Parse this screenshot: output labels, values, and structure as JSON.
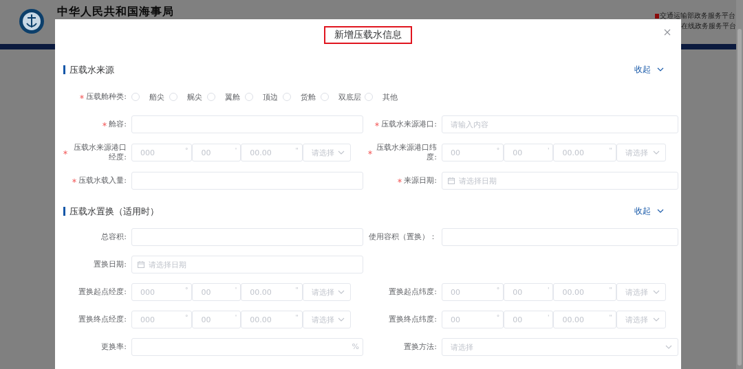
{
  "site": {
    "title": "中华人民共和国海事局",
    "platform_links": [
      "交通运输部政务服务平台",
      "在线政务服务平台"
    ]
  },
  "dialog": {
    "title": "新增压载水信息",
    "sections": [
      {
        "title": "压载水来源",
        "toggle": "收起",
        "rows": [
          [
            {
              "kind": "radio",
              "label": "压载舱种类:",
              "required": true,
              "options": [
                {
                  "label": "艏尖",
                  "selected": false
                },
                {
                  "label": "艉尖",
                  "selected": false
                },
                {
                  "label": "翼舱",
                  "selected": false
                },
                {
                  "label": "顶边",
                  "selected": false
                },
                {
                  "label": "货舱",
                  "selected": false
                },
                {
                  "label": "双底层",
                  "selected": false
                },
                {
                  "label": "其他",
                  "selected": false
                }
              ]
            }
          ],
          [
            {
              "kind": "text",
              "label": "舱容:",
              "required": true
            },
            {
              "kind": "text",
              "label": "压载水来源港口:",
              "required": true,
              "placeholder": "请输入内容"
            }
          ],
          [
            {
              "kind": "coord",
              "label": "压载水来源港口经度:",
              "required": true,
              "parts": [
                {
                  "placeholder": "000",
                  "unit": "°"
                },
                {
                  "placeholder": "00",
                  "unit": "'"
                },
                {
                  "placeholder": "00.00",
                  "unit": "\""
                }
              ],
              "select": "请选择"
            },
            {
              "kind": "coord",
              "label": "压载水来源港口纬度:",
              "required": true,
              "parts": [
                {
                  "placeholder": "00",
                  "unit": "°"
                },
                {
                  "placeholder": "00",
                  "unit": "'"
                },
                {
                  "placeholder": "00.00",
                  "unit": "\""
                }
              ],
              "select": "请选择"
            }
          ],
          [
            {
              "kind": "text",
              "label": "压载水载入量:",
              "required": true
            },
            {
              "kind": "date",
              "label": "来源日期:",
              "required": true,
              "placeholder": "请选择日期"
            }
          ]
        ]
      },
      {
        "title": "压载水置换（适用时）",
        "toggle": "收起",
        "rows": [
          [
            {
              "kind": "text",
              "label": "总容积:",
              "required": false
            },
            {
              "kind": "text",
              "label": "使用容积（置换）：",
              "required": false
            }
          ],
          [
            {
              "kind": "date",
              "label": "置换日期:",
              "required": false,
              "placeholder": "请选择日期"
            }
          ],
          [
            {
              "kind": "coord",
              "label": "置换起点经度:",
              "required": false,
              "parts": [
                {
                  "placeholder": "000",
                  "unit": "°"
                },
                {
                  "placeholder": "00",
                  "unit": "'"
                },
                {
                  "placeholder": "00.00",
                  "unit": "\""
                }
              ],
              "select": "请选择"
            },
            {
              "kind": "coord",
              "label": "置换起点纬度:",
              "required": false,
              "parts": [
                {
                  "placeholder": "00",
                  "unit": "°"
                },
                {
                  "placeholder": "00",
                  "unit": "'"
                },
                {
                  "placeholder": "00.00",
                  "unit": "\""
                }
              ],
              "select": "请选择"
            }
          ],
          [
            {
              "kind": "coord",
              "label": "置换终点经度:",
              "required": false,
              "parts": [
                {
                  "placeholder": "000",
                  "unit": "°"
                },
                {
                  "placeholder": "00",
                  "unit": "'"
                },
                {
                  "placeholder": "00.00",
                  "unit": "\""
                }
              ],
              "select": "请选择"
            },
            {
              "kind": "coord",
              "label": "置换终点纬度:",
              "required": false,
              "parts": [
                {
                  "placeholder": "00",
                  "unit": "°"
                },
                {
                  "placeholder": "00",
                  "unit": "'"
                },
                {
                  "placeholder": "00.00",
                  "unit": "\""
                }
              ],
              "select": "请选择"
            }
          ],
          [
            {
              "kind": "text",
              "label": "更换率:",
              "required": false,
              "suffix": "%"
            },
            {
              "kind": "select",
              "label": "置换方法:",
              "required": false,
              "placeholder": "请选择"
            }
          ]
        ]
      }
    ]
  }
}
